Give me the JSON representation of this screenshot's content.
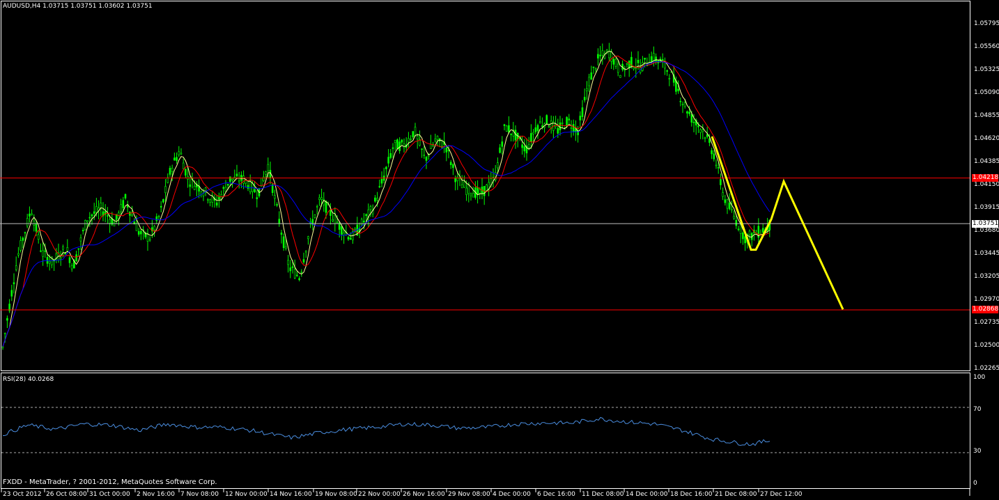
{
  "header": {
    "symbol_line": "AUDUSD,H4  1.03715 1.03751 1.03602 1.03751"
  },
  "rsi": {
    "label": "RSI(28) 40.0268",
    "levels": [
      "100",
      "70",
      "30",
      "0"
    ]
  },
  "footer": {
    "text": "FXDD - MetaTrader, ? 2001-2012, MetaQuotes Software Corp."
  },
  "price_axis": {
    "ticks": [
      "1.05795",
      "1.05560",
      "1.05325",
      "1.05090",
      "1.04855",
      "1.04620",
      "1.04385",
      "1.04150",
      "1.03915",
      "1.03680",
      "1.03445",
      "1.03205",
      "1.02970",
      "1.02735",
      "1.02500",
      "1.02265"
    ],
    "highlights": {
      "resistance": "1.04218",
      "current": "1.03751",
      "support": "1.02868"
    }
  },
  "time_axis": {
    "ticks": [
      "23 Oct 2012",
      "26 Oct 08:00",
      "31 Oct 00:00",
      "2 Nov 16:00",
      "7 Nov 08:00",
      "12 Nov 00:00",
      "14 Nov 16:00",
      "19 Nov 08:00",
      "22 Nov 00:00",
      "26 Nov 16:00",
      "29 Nov 08:00",
      "4 Dec 00:00",
      "6 Dec 16:00",
      "11 Dec 08:00",
      "14 Dec 00:00",
      "18 Dec 16:00",
      "21 Dec 08:00",
      "27 Dec 12:00"
    ]
  },
  "colors": {
    "candles": "#00ff00",
    "ma_fast": "#ffff99",
    "ma_mid": "#ff0000",
    "ma_slow": "#0000ff",
    "hline": "#ff0000",
    "projection": "#ffff00",
    "rsi_line": "#4a8ddf"
  },
  "chart_data": {
    "type": "line",
    "series": [],
    "key_points": {
      "close_path": [
        [
          0,
          1.023
        ],
        [
          10,
          1.0275
        ],
        [
          25,
          1.034
        ],
        [
          45,
          1.039
        ],
        [
          60,
          1.0345
        ],
        [
          75,
          1.0335
        ],
        [
          95,
          1.035
        ],
        [
          105,
          1.033
        ],
        [
          125,
          1.038
        ],
        [
          145,
          1.039
        ],
        [
          165,
          1.0375
        ],
        [
          180,
          1.04
        ],
        [
          200,
          1.0365
        ],
        [
          215,
          1.036
        ],
        [
          230,
          1.0385
        ],
        [
          245,
          1.043
        ],
        [
          258,
          1.045
        ],
        [
          270,
          1.042
        ],
        [
          290,
          1.041
        ],
        [
          310,
          1.0395
        ],
        [
          330,
          1.042
        ],
        [
          350,
          1.042
        ],
        [
          370,
          1.0405
        ],
        [
          385,
          1.0435
        ],
        [
          400,
          1.038
        ],
        [
          415,
          1.033
        ],
        [
          430,
          1.032
        ],
        [
          445,
          1.037
        ],
        [
          460,
          1.04
        ],
        [
          475,
          1.0385
        ],
        [
          490,
          1.037
        ],
        [
          505,
          1.036
        ],
        [
          520,
          1.0375
        ],
        [
          535,
          1.039
        ],
        [
          550,
          1.042
        ],
        [
          565,
          1.0455
        ],
        [
          580,
          1.0455
        ],
        [
          595,
          1.047
        ],
        [
          610,
          1.044
        ],
        [
          625,
          1.046
        ],
        [
          640,
          1.0455
        ],
        [
          655,
          1.042
        ],
        [
          670,
          1.041
        ],
        [
          690,
          1.0405
        ],
        [
          710,
          1.042
        ],
        [
          725,
          1.0475
        ],
        [
          740,
          1.0465
        ],
        [
          755,
          1.045
        ],
        [
          770,
          1.0475
        ],
        [
          785,
          1.048
        ],
        [
          800,
          1.047
        ],
        [
          815,
          1.048
        ],
        [
          830,
          1.047
        ],
        [
          845,
          1.052
        ],
        [
          860,
          1.0545
        ],
        [
          875,
          1.055
        ],
        [
          890,
          1.053
        ],
        [
          905,
          1.054
        ],
        [
          920,
          1.0535
        ],
        [
          935,
          1.0545
        ],
        [
          950,
          1.054
        ],
        [
          965,
          1.0525
        ],
        [
          980,
          1.05
        ],
        [
          995,
          1.048
        ],
        [
          1010,
          1.047
        ],
        [
          1025,
          1.0445
        ],
        [
          1040,
          1.04
        ],
        [
          1055,
          1.038
        ],
        [
          1070,
          1.036
        ],
        [
          1085,
          1.0365
        ],
        [
          1100,
          1.037
        ],
        [
          1107,
          1.0375
        ]
      ],
      "yellow_projection": [
        [
          1022,
          1.0464
        ],
        [
          1078,
          1.0348
        ],
        [
          1085,
          1.0348
        ],
        [
          1107,
          1.0379
        ],
        [
          1125,
          1.0418
        ],
        [
          1210,
          1.0287
        ]
      ],
      "rsi_values": [
        [
          0,
          45
        ],
        [
          40,
          55
        ],
        [
          80,
          51
        ],
        [
          120,
          56
        ],
        [
          160,
          55
        ],
        [
          200,
          50
        ],
        [
          240,
          56
        ],
        [
          280,
          53
        ],
        [
          320,
          53
        ],
        [
          360,
          50
        ],
        [
          400,
          45
        ],
        [
          420,
          43
        ],
        [
          460,
          48
        ],
        [
          500,
          51
        ],
        [
          540,
          53
        ],
        [
          580,
          56
        ],
        [
          620,
          55
        ],
        [
          660,
          52
        ],
        [
          700,
          53
        ],
        [
          740,
          56
        ],
        [
          780,
          57
        ],
        [
          820,
          57
        ],
        [
          860,
          61
        ],
        [
          900,
          58
        ],
        [
          940,
          56
        ],
        [
          980,
          50
        ],
        [
          1020,
          42
        ],
        [
          1060,
          38
        ],
        [
          1080,
          37
        ],
        [
          1100,
          40
        ],
        [
          1107,
          40
        ]
      ]
    }
  }
}
